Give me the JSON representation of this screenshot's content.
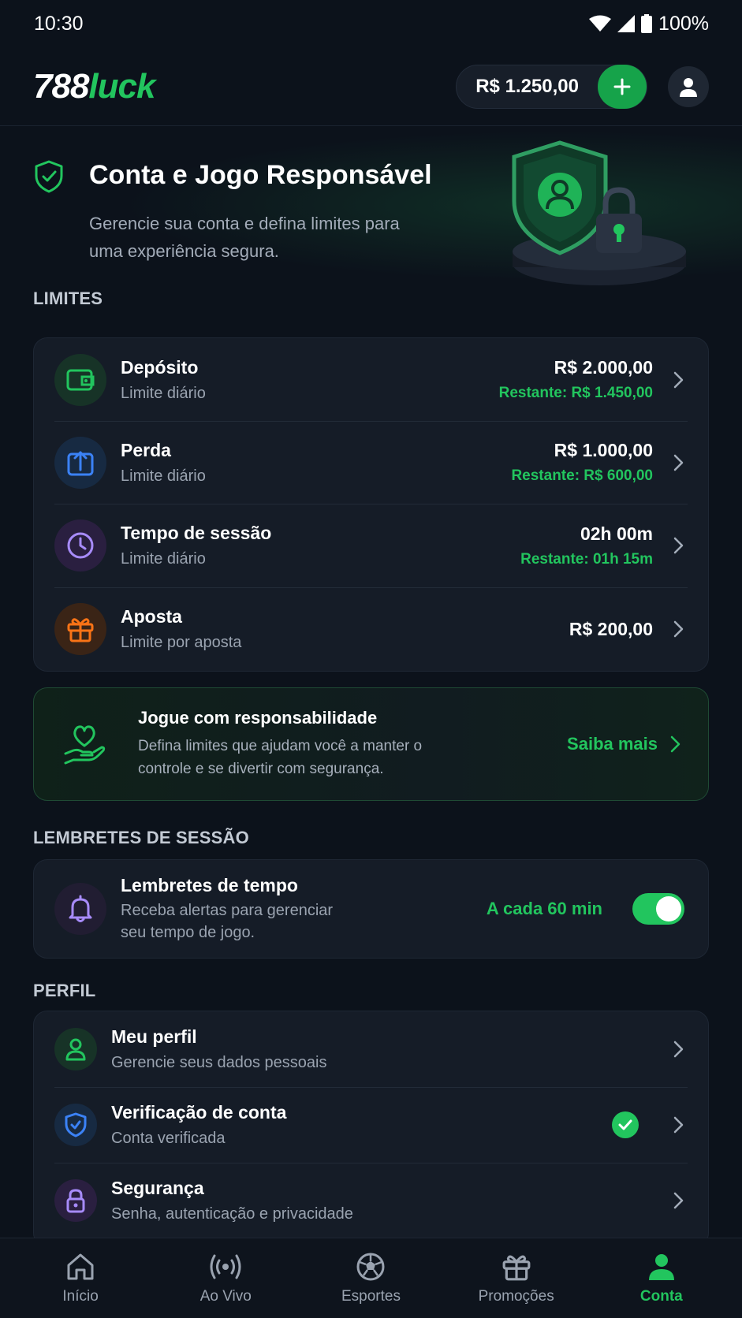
{
  "status_bar": {
    "time": "10:30",
    "battery": "100%"
  },
  "header": {
    "logo_number": "788",
    "logo_word": "luck",
    "balance": "R$ 1.250,00"
  },
  "hero": {
    "title": "Conta e Jogo Responsável",
    "subtitle": "Gerencie sua conta e defina limites para uma experiência segura."
  },
  "limits": {
    "section_title": "LIMITES",
    "items": [
      {
        "title": "Depósito",
        "subtitle": "Limite diário",
        "value": "R$ 2.000,00",
        "remaining": "Restante: R$ 1.450,00",
        "icon": "wallet-icon"
      },
      {
        "title": "Perda",
        "subtitle": "Limite diário",
        "value": "R$ 1.000,00",
        "remaining": "Restante: R$ 600,00",
        "icon": "upload-arrow-icon"
      },
      {
        "title": "Tempo de sessão",
        "subtitle": "Limite diário",
        "value": "02h 00m",
        "remaining": "Restante: 01h 15m",
        "icon": "clock-icon"
      },
      {
        "title": "Aposta",
        "subtitle": "Limite por aposta",
        "value": "R$ 200,00",
        "icon": "gift-icon"
      }
    ]
  },
  "promo": {
    "title": "Jogue com responsabilidade",
    "body": "Defina limites que ajudam você a manter o controle e se divertir com segurança.",
    "link": "Saiba mais"
  },
  "reminders": {
    "section_title": "LEMBRETES DE SESSÃO",
    "title": "Lembretes de tempo",
    "subtitle": "Receba alertas para gerenciar seu tempo de jogo.",
    "value": "A cada 60 min",
    "enabled": true
  },
  "profile": {
    "section_title": "PERFIL",
    "items": [
      {
        "title": "Meu perfil",
        "subtitle": "Gerencie seus dados pessoais",
        "icon": "user-icon"
      },
      {
        "title": "Verificação de conta",
        "subtitle": "Conta verificada",
        "icon": "shield-check-icon",
        "verified": true
      },
      {
        "title": "Segurança",
        "subtitle": "Senha, autenticação e privacidade",
        "icon": "lock-icon"
      }
    ]
  },
  "bottom_nav": {
    "items": [
      {
        "label": "Início",
        "icon": "home-icon"
      },
      {
        "label": "Ao Vivo",
        "icon": "live-broadcast-icon"
      },
      {
        "label": "Esportes",
        "icon": "soccer-ball-icon"
      },
      {
        "label": "Promoções",
        "icon": "gift-icon"
      },
      {
        "label": "Conta",
        "icon": "user-icon",
        "active": true
      }
    ]
  },
  "colors": {
    "background": "#0c121b",
    "card": "#151c27",
    "accent": "#22c55e",
    "accent_dark": "#16a34a"
  }
}
